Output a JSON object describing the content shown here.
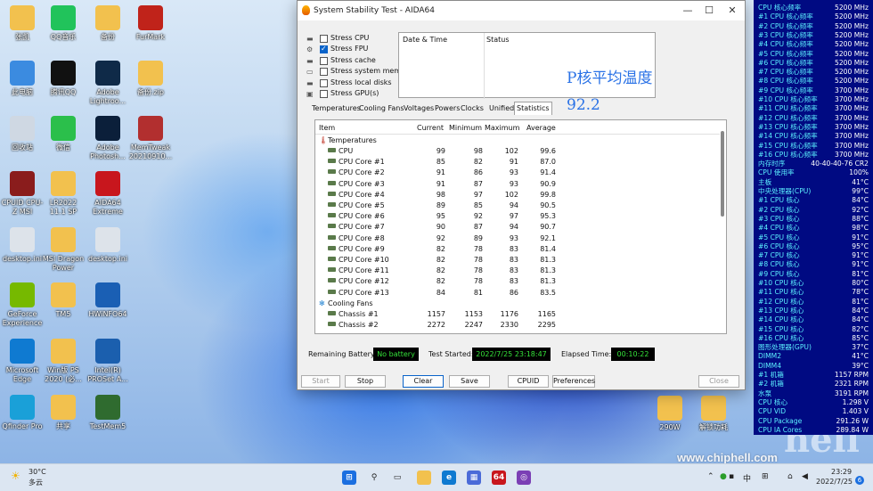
{
  "window": {
    "title": "System Stability Test - AIDA64",
    "stress_options": [
      {
        "label": "Stress CPU",
        "checked": false,
        "icon": "cpu-chip-icon"
      },
      {
        "label": "Stress FPU",
        "checked": true,
        "icon": "fpu-icon"
      },
      {
        "label": "Stress cache",
        "checked": false,
        "icon": "cache-icon"
      },
      {
        "label": "Stress system memory",
        "checked": false,
        "icon": "memory-icon"
      },
      {
        "label": "Stress local disks",
        "checked": false,
        "icon": "disk-icon"
      },
      {
        "label": "Stress GPU(s)",
        "checked": false,
        "icon": "gpu-icon"
      }
    ],
    "log_headers": {
      "date_time": "Date & Time",
      "status": "Status"
    },
    "tabs": [
      "Temperatures",
      "Cooling Fans",
      "Voltages",
      "Powers",
      "Clocks",
      "Unified",
      "Statistics"
    ],
    "active_tab": "Statistics",
    "grid_headers": {
      "item": "Item",
      "current": "Current",
      "minimum": "Minimum",
      "maximum": "Maximum",
      "average": "Average"
    },
    "groups": {
      "temperatures": "Temperatures",
      "cooling_fans": "Cooling Fans"
    },
    "temp_rows": [
      {
        "name": "CPU",
        "cur": "99",
        "min": "98",
        "max": "102",
        "avg": "99.6"
      },
      {
        "name": "CPU Core #1",
        "cur": "85",
        "min": "82",
        "max": "91",
        "avg": "87.0"
      },
      {
        "name": "CPU Core #2",
        "cur": "91",
        "min": "86",
        "max": "93",
        "avg": "91.4"
      },
      {
        "name": "CPU Core #3",
        "cur": "91",
        "min": "87",
        "max": "93",
        "avg": "90.9"
      },
      {
        "name": "CPU Core #4",
        "cur": "98",
        "min": "97",
        "max": "102",
        "avg": "99.8"
      },
      {
        "name": "CPU Core #5",
        "cur": "89",
        "min": "85",
        "max": "94",
        "avg": "90.5"
      },
      {
        "name": "CPU Core #6",
        "cur": "95",
        "min": "92",
        "max": "97",
        "avg": "95.3"
      },
      {
        "name": "CPU Core #7",
        "cur": "90",
        "min": "87",
        "max": "94",
        "avg": "90.7"
      },
      {
        "name": "CPU Core #8",
        "cur": "92",
        "min": "89",
        "max": "93",
        "avg": "92.1"
      },
      {
        "name": "CPU Core #9",
        "cur": "82",
        "min": "78",
        "max": "83",
        "avg": "81.4"
      },
      {
        "name": "CPU Core #10",
        "cur": "82",
        "min": "78",
        "max": "83",
        "avg": "81.3"
      },
      {
        "name": "CPU Core #11",
        "cur": "82",
        "min": "78",
        "max": "83",
        "avg": "81.3"
      },
      {
        "name": "CPU Core #12",
        "cur": "82",
        "min": "78",
        "max": "83",
        "avg": "81.3"
      },
      {
        "name": "CPU Core #13",
        "cur": "84",
        "min": "81",
        "max": "86",
        "avg": "83.5"
      }
    ],
    "fan_rows": [
      {
        "name": "Chassis #1",
        "cur": "1157",
        "min": "1153",
        "max": "1176",
        "avg": "1165"
      },
      {
        "name": "Chassis #2",
        "cur": "2272",
        "min": "2247",
        "max": "2330",
        "avg": "2295"
      }
    ],
    "overlay_text_1": "P核平均温度",
    "overlay_text_2": "92.2",
    "status": {
      "remaining_battery_label": "Remaining Battery:",
      "remaining_battery_value": "No battery",
      "test_started_label": "Test Started:",
      "test_started_value": "2022/7/25 23:18:47",
      "elapsed_label": "Elapsed Time:",
      "elapsed_value": "00:10:22"
    },
    "buttons": {
      "start": "Start",
      "stop": "Stop",
      "clear": "Clear",
      "save": "Save",
      "cpuid": "CPUID",
      "preferences": "Preferences",
      "close": "Close"
    }
  },
  "desktop_icons": [
    {
      "label": "张凯",
      "color": "#f2c14e"
    },
    {
      "label": "QQ音乐",
      "color": "#21c35b"
    },
    {
      "label": "备份",
      "color": "#f2c14e"
    },
    {
      "label": "FurMark",
      "color": "#c0231a"
    },
    {
      "label": "此电脑",
      "color": "#3b8be0"
    },
    {
      "label": "腾讯QQ",
      "color": "#111111"
    },
    {
      "label": "Adobe Lightroo...",
      "color": "#0f2a48"
    },
    {
      "label": "备份.zip",
      "color": "#f2c14e"
    },
    {
      "label": "回收站",
      "color": "#cfd8e3"
    },
    {
      "label": "微信",
      "color": "#2bbf4b"
    },
    {
      "label": "Adobe Photosh...",
      "color": "#0b1f3a"
    },
    {
      "label": "MemTweak 20210910...",
      "color": "#b22f2f"
    },
    {
      "label": "CPUID CPU-Z MSI",
      "color": "#8a1c1c"
    },
    {
      "label": "LR2022 11.1 SP",
      "color": "#f2c14e"
    },
    {
      "label": "AIDA64 Extreme",
      "color": "#c8161d"
    },
    {
      "label": "desktop.ini",
      "color": "#dde3ea"
    },
    {
      "label": "MSI Dragon Power",
      "color": "#f2c14e"
    },
    {
      "label": "desktop.ini",
      "color": "#dde3ea"
    },
    {
      "label": "GeForce Experience",
      "color": "#76b900"
    },
    {
      "label": "TM5",
      "color": "#f2c14e"
    },
    {
      "label": "HWiNFO64",
      "color": "#1a5fb4"
    },
    {
      "label": "Microsoft Edge",
      "color": "#0f7ad1"
    },
    {
      "label": "Win版 PS 2020 (必...",
      "color": "#f2c14e"
    },
    {
      "label": "Intel(R) PROSet A...",
      "color": "#1b5fae"
    },
    {
      "label": "Qfinder Pro",
      "color": "#1aa0d8"
    },
    {
      "label": "共享",
      "color": "#f2c14e"
    },
    {
      "label": "TestMem5",
      "color": "#2f6b2f"
    },
    {
      "label": "290W",
      "color": "#f2c14e"
    },
    {
      "label": "解锁功耗",
      "color": "#f2c14e"
    }
  ],
  "osd": [
    {
      "l": "CPU 核心频率",
      "v": "5200 MHz"
    },
    {
      "l": "#1 CPU 核心频率",
      "v": "5200 MHz"
    },
    {
      "l": "#2 CPU 核心频率",
      "v": "5200 MHz"
    },
    {
      "l": "#3 CPU 核心频率",
      "v": "5200 MHz"
    },
    {
      "l": "#4 CPU 核心频率",
      "v": "5200 MHz"
    },
    {
      "l": "#5 CPU 核心频率",
      "v": "5200 MHz"
    },
    {
      "l": "#6 CPU 核心频率",
      "v": "5200 MHz"
    },
    {
      "l": "#7 CPU 核心频率",
      "v": "5200 MHz"
    },
    {
      "l": "#8 CPU 核心频率",
      "v": "5200 MHz"
    },
    {
      "l": "#9 CPU 核心频率",
      "v": "3700 MHz"
    },
    {
      "l": "#10 CPU 核心频率",
      "v": "3700 MHz"
    },
    {
      "l": "#11 CPU 核心频率",
      "v": "3700 MHz"
    },
    {
      "l": "#12 CPU 核心频率",
      "v": "3700 MHz"
    },
    {
      "l": "#13 CPU 核心频率",
      "v": "3700 MHz"
    },
    {
      "l": "#14 CPU 核心频率",
      "v": "3700 MHz"
    },
    {
      "l": "#15 CPU 核心频率",
      "v": "3700 MHz"
    },
    {
      "l": "#16 CPU 核心频率",
      "v": "3700 MHz"
    },
    {
      "l": "内存时序",
      "v": "40-40-40-76 CR2"
    },
    {
      "l": "CPU 使用率",
      "v": "100%"
    },
    {
      "l": "主板",
      "v": "41°C"
    },
    {
      "l": "中央处理器(CPU)",
      "v": "99°C"
    },
    {
      "l": "#1 CPU 核心",
      "v": "84°C"
    },
    {
      "l": "#2 CPU 核心",
      "v": "92°C"
    },
    {
      "l": "#3 CPU 核心",
      "v": "88°C"
    },
    {
      "l": "#4 CPU 核心",
      "v": "98°C"
    },
    {
      "l": "#5 CPU 核心",
      "v": "91°C"
    },
    {
      "l": "#6 CPU 核心",
      "v": "95°C"
    },
    {
      "l": "#7 CPU 核心",
      "v": "91°C"
    },
    {
      "l": "#8 CPU 核心",
      "v": "91°C"
    },
    {
      "l": "#9 CPU 核心",
      "v": "81°C"
    },
    {
      "l": "#10 CPU 核心",
      "v": "80°C"
    },
    {
      "l": "#11 CPU 核心",
      "v": "78°C"
    },
    {
      "l": "#12 CPU 核心",
      "v": "81°C"
    },
    {
      "l": "#13 CPU 核心",
      "v": "84°C"
    },
    {
      "l": "#14 CPU 核心",
      "v": "84°C"
    },
    {
      "l": "#15 CPU 核心",
      "v": "82°C"
    },
    {
      "l": "#16 CPU 核心",
      "v": "85°C"
    },
    {
      "l": "图形处理器(GPU)",
      "v": "37°C"
    },
    {
      "l": "DIMM2",
      "v": "41°C"
    },
    {
      "l": "DIMM4",
      "v": "39°C"
    },
    {
      "l": "#1 机箱",
      "v": "1157 RPM"
    },
    {
      "l": "#2 机箱",
      "v": "2321 RPM"
    },
    {
      "l": "水泵",
      "v": "3191 RPM"
    },
    {
      "l": "CPU 核心",
      "v": "1.298 V"
    },
    {
      "l": "CPU VID",
      "v": "1.403 V"
    },
    {
      "l": "CPU Package",
      "v": "291.26 W"
    },
    {
      "l": "CPU IA Cores",
      "v": "289.84 W"
    }
  ],
  "taskbar": {
    "weather_temp": "30°C",
    "weather_desc": "多云",
    "ime": "中",
    "time": "23:29",
    "date": "2022/7/25",
    "notification_count": "6"
  },
  "watermark": "www.chiphell.com",
  "colors": {
    "osd_bg": "#000a82",
    "osd_label": "#5cf0ff",
    "osd_value": "#ffffff",
    "accent": "#0a63c9"
  }
}
